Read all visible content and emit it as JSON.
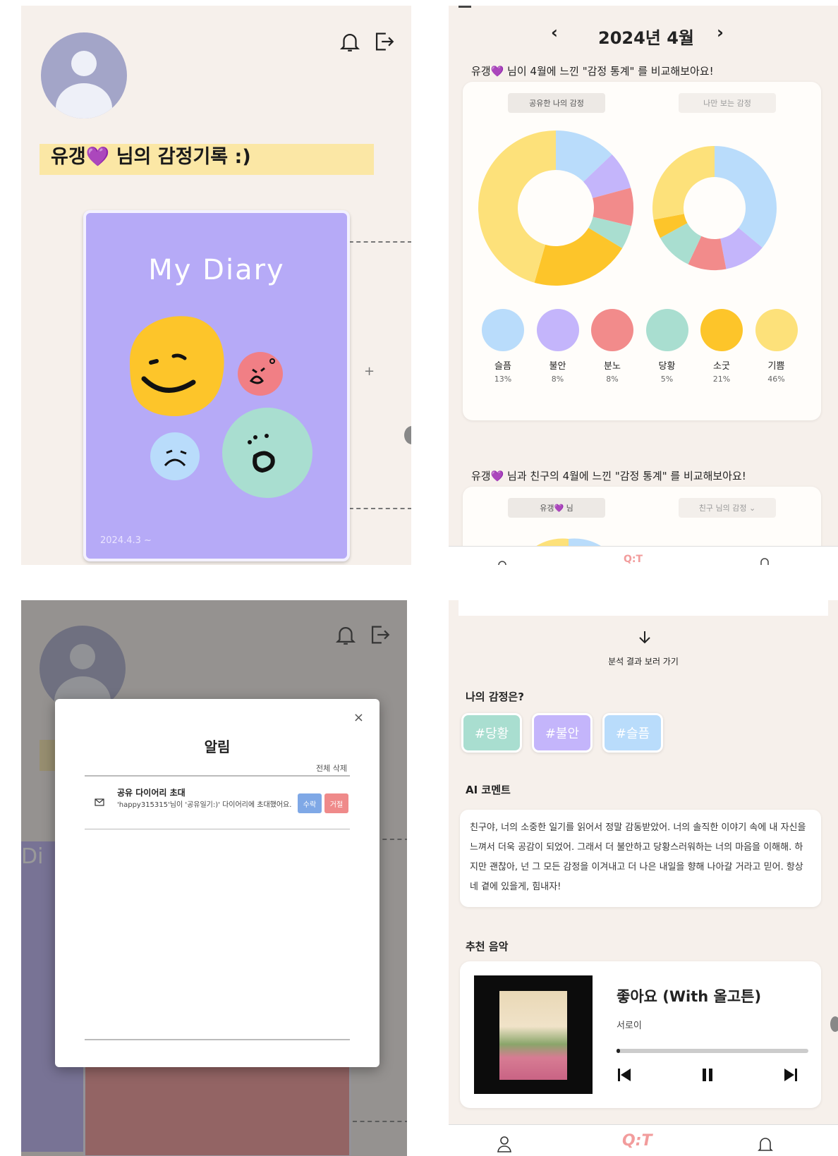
{
  "profile": {
    "record_text": "유갱💜 님의 감정기록 :)",
    "diary_title": "My Diary",
    "diary_date": "2024.4.3 ~"
  },
  "stats": {
    "month": "2024년 4월",
    "prev": "‹",
    "next": "›",
    "heading1": "유갱💜 님이 4월에 느낀 \"감정 통계\" 를 비교해보아요!",
    "tab_mine": "공유한 나의 감정",
    "tab_all": "나만 보는 감정",
    "emotions": [
      {
        "name": "슬픔",
        "pct": "13%",
        "color": "#b9dcfb"
      },
      {
        "name": "불안",
        "pct": "8%",
        "color": "#c4b5fb"
      },
      {
        "name": "분노",
        "pct": "8%",
        "color": "#f28b8b"
      },
      {
        "name": "당황",
        "pct": "5%",
        "color": "#a9ded0"
      },
      {
        "name": "소굿",
        "pct": "21%",
        "color": "#fdc52a"
      },
      {
        "name": "기쁨",
        "pct": "46%",
        "color": "#fde17a"
      }
    ],
    "heading2": "유갱💜 님과 친구의 4월에 느낀 \"감정 통계\" 를 비교해보아요!",
    "tab_user": "유갱💜 님",
    "tab_friend": "친구 님의 감정"
  },
  "chart_data": [
    {
      "type": "pie",
      "title": "공유한 나의 감정",
      "categories": [
        "슬픔",
        "불안",
        "분노",
        "당황",
        "소굿",
        "기쁨"
      ],
      "values": [
        13,
        8,
        8,
        5,
        21,
        46
      ],
      "colors": [
        "#b9dcfb",
        "#c4b5fb",
        "#f28b8b",
        "#a9ded0",
        "#fdc52a",
        "#fde17a"
      ]
    },
    {
      "type": "pie",
      "title": "나만 보는 감정",
      "categories": [
        "슬픔",
        "불안",
        "분노",
        "당황",
        "소굿",
        "기쁨"
      ],
      "values": [
        36,
        11,
        10,
        10,
        5,
        28
      ],
      "colors": [
        "#b9dcfb",
        "#c4b5fb",
        "#f28b8b",
        "#a9ded0",
        "#fdc52a",
        "#fde17a"
      ]
    }
  ],
  "notification": {
    "title": "알림",
    "close": "×",
    "delete_all": "전체 삭제",
    "item_title": "공유 다이어리 초대",
    "item_body": "'happy315315'님이 '공유일기:)' 다이어리에 초대했어요.",
    "accept": "수락",
    "reject": "거절"
  },
  "analysis": {
    "go_results": "분석 결과 보러 가기",
    "my_emotions_label": "나의 감정은?",
    "tags": [
      {
        "label": "#당황",
        "color": "#a9ded0"
      },
      {
        "label": "#불안",
        "color": "#c4b5fb"
      },
      {
        "label": "#슬픔",
        "color": "#b9dcfb"
      }
    ],
    "ai_label": "AI 코멘트",
    "ai_comment": "친구야, 너의 소중한 일기를 읽어서 정말 감동받았어. 너의 솔직한 이야기 속에 내 자신을 느껴서 더욱 공감이 되었어. 그래서 더 불안하고 당황스러워하는 너의 마음을 이해해. 하지만 괜찮아, 넌 그 모든 감정을 이겨내고 더 나은 내일을 향해 나아갈 거라고 믿어. 항상 네 곁에 있을게, 힘내자!",
    "music_label": "추천 음악",
    "song_title": "좋아요 (With 올고튼)",
    "artist": "서로이",
    "progress": 0.02
  },
  "nav": {
    "logo": "Q:T"
  }
}
